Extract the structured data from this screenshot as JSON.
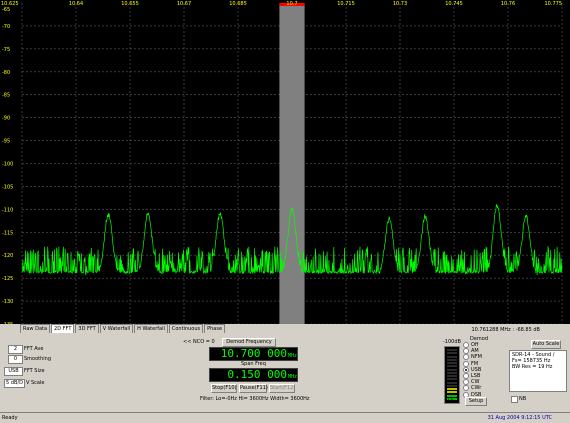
{
  "chart_data": {
    "type": "line",
    "x_ticks": [
      "10.625",
      "10.64",
      "10.655",
      "10.67",
      "10.685",
      "10.7",
      "10.715",
      "10.73",
      "10.745",
      "10.76",
      "10.775"
    ],
    "y_ticks": [
      "-65",
      "-70",
      "-75",
      "-80",
      "-85",
      "-90",
      "-95",
      "-100",
      "-105",
      "-110",
      "-115",
      "-120",
      "-125",
      "-130",
      "-135"
    ],
    "xlim": [
      10.625,
      10.775
    ],
    "ylim": [
      -135,
      -65
    ],
    "grid": true,
    "colors": {
      "background": "#000000",
      "trace": "#00ff00",
      "tick_text": "#ffff00",
      "highlight_band": "#808080",
      "marker": "#ff0000"
    },
    "noise_floor": -124,
    "noise_range": [
      -131,
      -117
    ],
    "highlight_band_x": [
      10.6965,
      10.7035
    ],
    "peaks": [
      {
        "x": 10.649,
        "y": -111
      },
      {
        "x": 10.66,
        "y": -111
      },
      {
        "x": 10.68,
        "y": -111
      },
      {
        "x": 10.7,
        "y": -110
      },
      {
        "x": 10.727,
        "y": -112
      },
      {
        "x": 10.737,
        "y": -111.5
      },
      {
        "x": 10.757,
        "y": -109
      },
      {
        "x": 10.765,
        "y": -111.5
      }
    ]
  },
  "tabs": [
    "Raw Data",
    "2D FFT",
    "3D FFT",
    "V Waterfall",
    "H Waterfall",
    "Continuous",
    "Phase"
  ],
  "active_tab": 1,
  "readout": "10.761288 MHz : -68.85 dB",
  "controls": {
    "fft_size_val": "2",
    "fft_ave_label": "FFT Ave",
    "smoothing_val": "0",
    "smoothing_label": "Smoothing",
    "fft_size_label": "FFT Size",
    "fft_size_select": "USB",
    "vscale_select": "5 dB/D",
    "vscale_label": "V Scale"
  },
  "center": {
    "nco_label": "<< NCO = 0",
    "demod_button": "Demod Frequency",
    "freq_value": "10.700 000",
    "freq_unit": "MHz",
    "span_label": "Span Freq",
    "span_value": "0.150 000",
    "span_unit": "MHz",
    "stop_button": "Stop(F10)",
    "pause_button": "Pause(F11)",
    "start_button": "Start(F12)",
    "filter_text": "Filter:  Lo=-0Hz  Hi= 3600Hz  Width= 3600Hz"
  },
  "meter": {
    "label": "-100dB",
    "value": "3.6"
  },
  "demod": {
    "title": "Demod",
    "modes": [
      "Off",
      "AM",
      "NFM",
      "FM",
      "USB",
      "LSB",
      "CW",
      "CWr",
      "DSB"
    ],
    "selected": "USB",
    "setup_button": "Setup"
  },
  "info": {
    "auto_scale": "Auto Scale",
    "lines": [
      "SDR-14 - Sound  /",
      "Fs= 158735 Hz",
      "BW Res = 19 Hz"
    ],
    "nb_label": "NB"
  },
  "status": {
    "left": "Ready",
    "right": "31 Aug 2004  9:12:15 UTC"
  }
}
